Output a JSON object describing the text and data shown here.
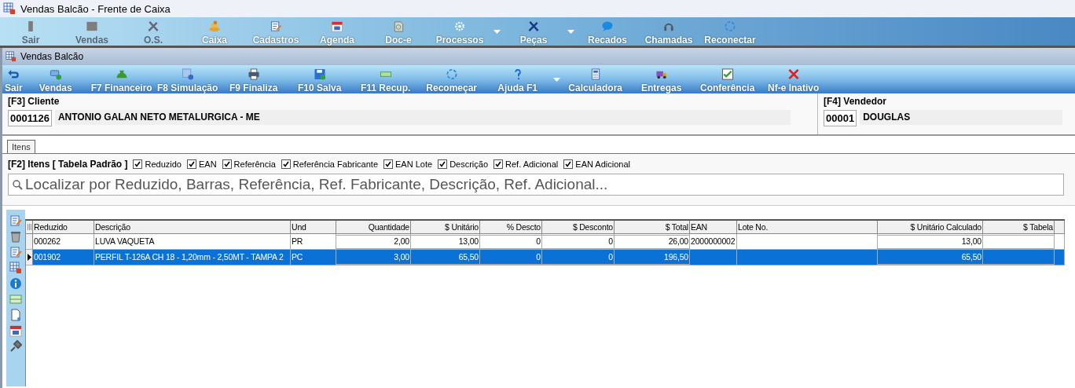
{
  "window": {
    "title": "Vendas Balcão - Frente de Caixa"
  },
  "main_toolbar": [
    {
      "label": "Sair",
      "disabled": true,
      "dropdown": false
    },
    {
      "label": "Vendas",
      "disabled": true,
      "dropdown": false
    },
    {
      "label": "O.S.",
      "disabled": true,
      "dropdown": false
    },
    {
      "label": "Caixa",
      "disabled": false,
      "dropdown": false
    },
    {
      "label": "Cadastros",
      "disabled": false,
      "dropdown": false
    },
    {
      "label": "Agenda",
      "disabled": false,
      "dropdown": false
    },
    {
      "label": "Doc-e",
      "disabled": false,
      "dropdown": false
    },
    {
      "label": "Processos",
      "disabled": false,
      "dropdown": true
    },
    {
      "label": "Peças",
      "disabled": false,
      "dropdown": true
    },
    {
      "label": "Recados",
      "disabled": false,
      "dropdown": false
    },
    {
      "label": "Chamadas",
      "disabled": false,
      "dropdown": false
    },
    {
      "label": "Reconectar",
      "disabled": false,
      "dropdown": false
    }
  ],
  "sub_window": {
    "title": "Vendas Balcão"
  },
  "sub_toolbar": [
    {
      "label": "Sair",
      "dropdown": false
    },
    {
      "label": "Vendas",
      "dropdown": false
    },
    {
      "label": "F7 Financeiro",
      "dropdown": false
    },
    {
      "label": "F8 Simulação",
      "dropdown": false
    },
    {
      "label": "F9 Finaliza",
      "dropdown": false
    },
    {
      "label": "F10 Salva",
      "dropdown": false
    },
    {
      "label": "F11 Recup.",
      "dropdown": false
    },
    {
      "label": "Recomeçar",
      "dropdown": false
    },
    {
      "label": "Ajuda F1",
      "dropdown": true
    },
    {
      "label": "Calculadora",
      "dropdown": false
    },
    {
      "label": "Entregas",
      "dropdown": false
    },
    {
      "label": "Conferência",
      "dropdown": false
    },
    {
      "label": "Nf-e Inativo",
      "dropdown": false
    }
  ],
  "cliente": {
    "label": "[F3] Cliente",
    "code": "0001126",
    "name": "ANTONIO GALAN NETO METALURGICA - ME"
  },
  "vendedor": {
    "label": "[F4] Vendedor",
    "code": "00001",
    "name": "DOUGLAS"
  },
  "tabs": [
    {
      "label": "Itens",
      "selected": true
    }
  ],
  "filter": {
    "label": "[F2] Itens [ Tabela Padrão ]",
    "options": [
      {
        "label": "Reduzido",
        "checked": true
      },
      {
        "label": "EAN",
        "checked": true
      },
      {
        "label": "Referência",
        "checked": true
      },
      {
        "label": "Referência Fabricante",
        "checked": true
      },
      {
        "label": "EAN Lote",
        "checked": true
      },
      {
        "label": "Descrição",
        "checked": true
      },
      {
        "label": "Ref. Adicional",
        "checked": true
      },
      {
        "label": "EAN Adicional",
        "checked": true
      }
    ]
  },
  "search": {
    "placeholder": "Localizar por Reduzido, Barras, Referência, Ref. Fabricante, Descrição, Ref. Adicional..."
  },
  "table": {
    "columns": [
      "Reduzido",
      "Descrição",
      "Und",
      "Quantidade",
      "$ Unitário",
      "% Descto",
      "$ Desconto",
      "$ Total",
      "EAN",
      "Lote No.",
      "$ Unitário Calculado",
      "$ Tabela"
    ],
    "rows": [
      {
        "selected": false,
        "cells": [
          "000262",
          "LUVA VAQUETA",
          "PR",
          "2,00",
          "13,00",
          "0",
          "0",
          "26,00",
          "2000000002",
          null,
          "13,00",
          null
        ]
      },
      {
        "selected": true,
        "cells": [
          "001902",
          "PERFIL T-126A CH 18 - 1,20mm - 2,50MT - TAMPA 2",
          "PC",
          "3,00",
          "65,50",
          "0",
          "0",
          "196,50",
          null,
          null,
          "65,50",
          null
        ]
      }
    ]
  }
}
